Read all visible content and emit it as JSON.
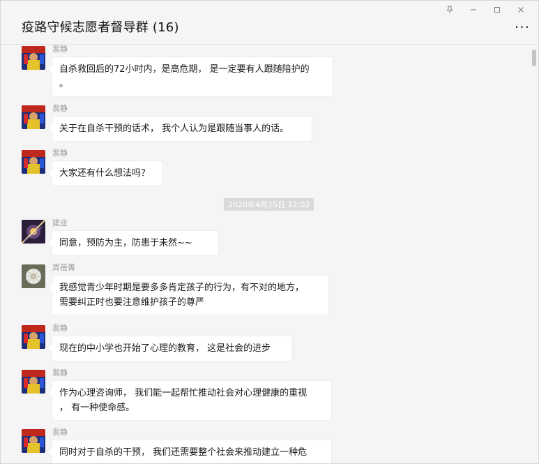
{
  "window": {
    "title": "疫路守候志愿者督导群 (16)",
    "more_label": "...",
    "controls": {
      "pin": "pin-icon",
      "minimize": "minimize-icon",
      "maximize": "maximize-icon",
      "close": "close-icon"
    }
  },
  "messages": [
    {
      "sender": "裴静",
      "text_lines": [
        "自杀救回后的72小时内，是高危期， 是一定要有人跟随陪护的",
        "。"
      ]
    },
    {
      "sender": "裴静",
      "text_lines": [
        "关于在自杀干预的话术， 我个人认为是跟随当事人的话。"
      ]
    },
    {
      "sender": "裴静",
      "text_lines": [
        "大家还有什么想法吗？"
      ]
    },
    {
      "sender": "建业",
      "text_lines": [
        "同意，预防为主，防患于未然~~"
      ]
    },
    {
      "sender": "周蓓菁",
      "text_lines": [
        "我感觉青少年时期是要多多肯定孩子的行为，有不对的地方，",
        "需要纠正时也要注意维护孩子的尊严"
      ]
    },
    {
      "sender": "裴静",
      "text_lines": [
        "现在的中小学也开始了心理的教育， 这是社会的进步"
      ]
    },
    {
      "sender": "裴静",
      "text_lines": [
        "作为心理咨询师， 我们能一起帮忙推动社会对心理健康的重视",
        "， 有一种使命感。"
      ]
    },
    {
      "sender": "裴静",
      "text_lines": [
        "同时对于自杀的干预， 我们还需要整个社会来推动建立一种危"
      ]
    }
  ],
  "timestamp": "2020年4月25日 12:02"
}
